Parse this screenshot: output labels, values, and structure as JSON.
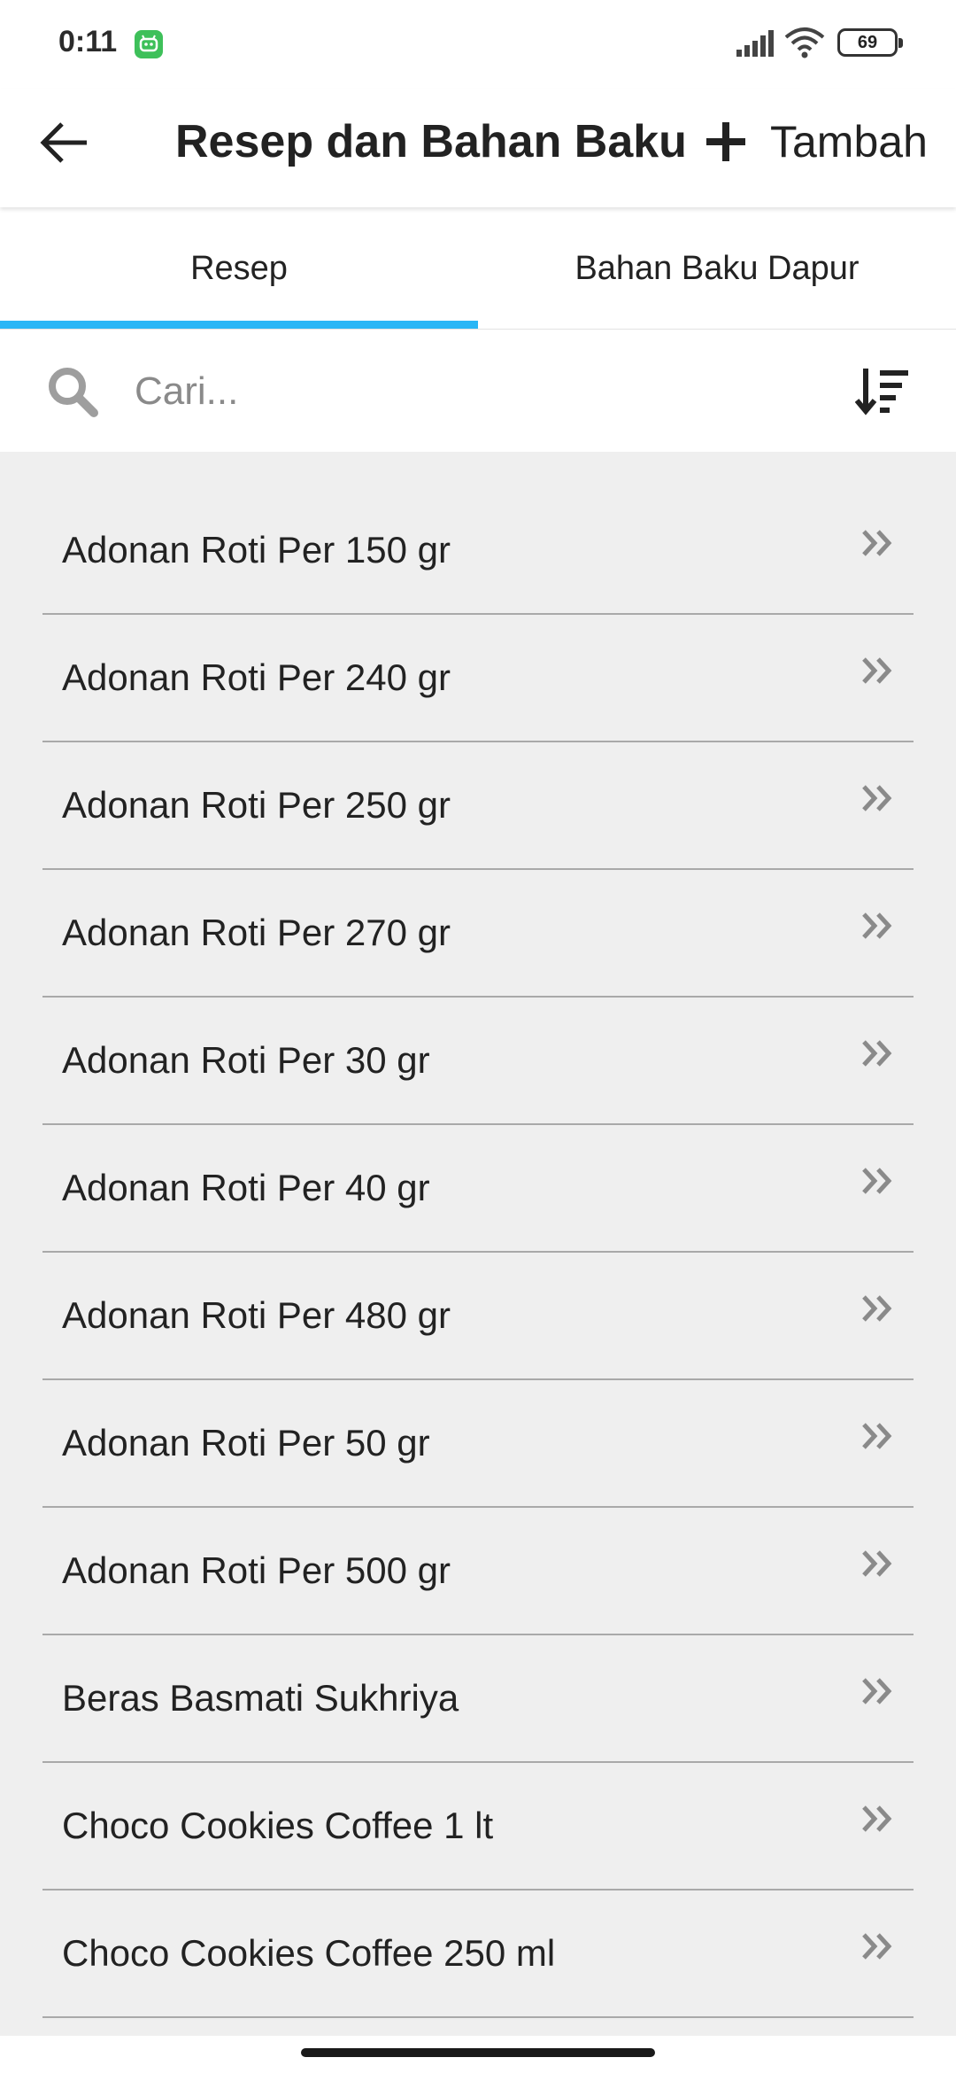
{
  "status_bar": {
    "time": "0:11",
    "battery": "69",
    "icons": [
      "app-notification-icon",
      "signal-icon",
      "wifi-icon",
      "battery-icon"
    ]
  },
  "header": {
    "title": "Resep dan Bahan Baku",
    "add_label": "Tambah",
    "back_icon": "arrow-left-icon",
    "add_icon": "plus-icon"
  },
  "tabs": [
    {
      "label": "Resep",
      "active": true
    },
    {
      "label": "Bahan Baku Dapur",
      "active": false
    }
  ],
  "search": {
    "placeholder": "Cari...",
    "value": "",
    "sort_icon": "sort-descending-icon"
  },
  "recipes": [
    {
      "name": "Adonan Roti Per 150 gr"
    },
    {
      "name": "Adonan Roti Per 240 gr"
    },
    {
      "name": "Adonan Roti Per 250 gr"
    },
    {
      "name": "Adonan Roti Per 270 gr"
    },
    {
      "name": "Adonan Roti Per 30 gr"
    },
    {
      "name": "Adonan Roti Per 40 gr"
    },
    {
      "name": "Adonan Roti Per 480 gr"
    },
    {
      "name": "Adonan Roti Per 50 gr"
    },
    {
      "name": "Adonan Roti Per 500 gr"
    },
    {
      "name": "Beras Basmati Sukhriya"
    },
    {
      "name": "Choco Cookies Coffee 1 lt"
    },
    {
      "name": "Choco Cookies Coffee 250 ml"
    }
  ],
  "colors": {
    "accent": "#29b6f6",
    "list_background": "#efefef",
    "divider": "#a9a9a9"
  }
}
